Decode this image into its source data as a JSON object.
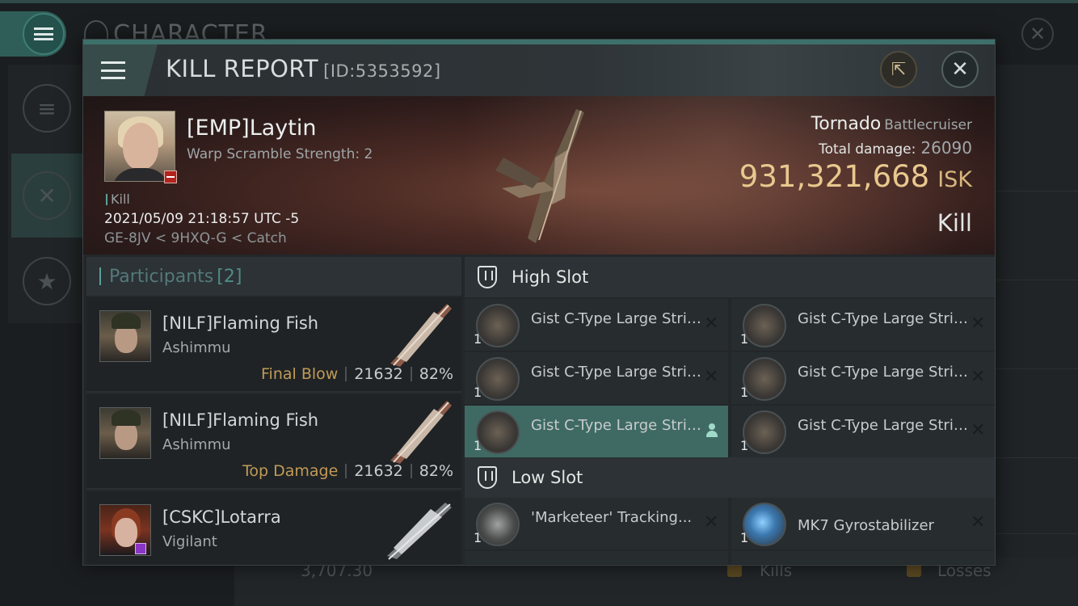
{
  "background": {
    "title": "CHARACTER",
    "footer": {
      "wallet": "3,707.30",
      "kills_label": "Kills",
      "losses_label": "Losses"
    }
  },
  "modal": {
    "title": "KILL REPORT",
    "id": "[ID:5353592]"
  },
  "victim": {
    "name": "[EMP]Laytin",
    "subtitle": "Warp Scramble Strength: 2",
    "kill_tag": "Kill",
    "datetime": "2021/05/09 21:18:57 UTC -5",
    "location": "GE-8JV < 9HXQ-G < Catch",
    "ship_name": "Tornado",
    "ship_class": "Battlecruiser",
    "total_damage_label": "Total damage:",
    "total_damage": "26090",
    "isk_value": "931,321,668",
    "isk_unit": "ISK",
    "result": "Kill"
  },
  "participants": {
    "label": "Participants",
    "count": "[2]",
    "rows": [
      {
        "name": "[NILF]Flaming Fish",
        "ship": "Ashimmu",
        "tag": "Final Blow",
        "damage": "21632",
        "percent": "82%"
      },
      {
        "name": "[NILF]Flaming Fish",
        "ship": "Ashimmu",
        "tag": "Top Damage",
        "damage": "21632",
        "percent": "82%"
      },
      {
        "name": "[CSKC]Lotarra",
        "ship": "Vigilant"
      }
    ]
  },
  "fitting": {
    "high_slot_label": "High Slot",
    "low_slot_label": "Low Slot",
    "high": [
      {
        "name": "Gist C-Type Large Strike...",
        "qty": "1"
      },
      {
        "name": "Gist C-Type Large Strike...",
        "qty": "1"
      },
      {
        "name": "Gist C-Type Large Strike...",
        "qty": "1"
      },
      {
        "name": "Gist C-Type Large Strike...",
        "qty": "1"
      },
      {
        "name": "Gist C-Type Large Strike...",
        "qty": "1"
      },
      {
        "name": "Gist C-Type Large Strike...",
        "qty": "1"
      }
    ],
    "low": [
      {
        "name": "'Marketeer' Tracking...",
        "qty": "1"
      },
      {
        "name": "MK7 Gyrostabilizer",
        "qty": "1"
      }
    ]
  },
  "colors": {
    "accent_teal": "#3e706b",
    "isk_gold": "#e8c88e",
    "tag_gold": "#c29b55",
    "selected_row": "#3f6a64"
  },
  "icons": [
    "menu-icon",
    "external-link-icon",
    "close-icon",
    "shield-icon",
    "person-icon",
    "remove-icon"
  ]
}
